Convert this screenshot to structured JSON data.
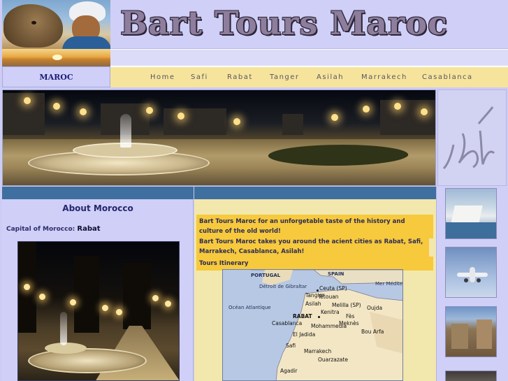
{
  "site": {
    "title": "Bart Tours Maroc"
  },
  "nav": {
    "left_label": "MAROC",
    "items": [
      "Home",
      "Safi",
      "Rabat",
      "Tanger",
      "Asilah",
      "Marrakech",
      "Casablanca"
    ]
  },
  "about": {
    "title": "About Morocco",
    "capital_label": "Capital of Morocco:",
    "capital_value": "Rabat"
  },
  "notes": [
    "Bart Tours Maroc for an unforgetable taste of the history and culture of the old world!",
    "Bart Tours Maroc takes you around the acient cities as Rabat, Safi, Marrakech, Casablanca, Asilah!",
    "Tours Itinerary"
  ],
  "map": {
    "regions": {
      "portugal": "PORTUGAL",
      "spain": "SPAIN",
      "strait": "Détroit de Gibraltar",
      "ocean": "Océan Atlantique",
      "sea": "Mer Méditerranée"
    },
    "cities": {
      "ceuta": "Ceuta",
      "ceuta_tag": "(SP)",
      "tetouan": "Tétouan",
      "tangier": "Tangier",
      "asilah": "Asilah",
      "melilla": "Melilla",
      "melilla_tag": "(SP)",
      "oujda": "Oujda",
      "kenitra": "Kenitra",
      "rabat": "RABAT",
      "fes": "Fès",
      "meknes": "Meknès",
      "casablanca": "Casablanca",
      "mohammedia": "Mohammedia",
      "eljadida": "El Jadida",
      "boufarfa": "Bou Arfa",
      "safi": "Safi",
      "marrakech": "Marrakech",
      "ouarzazate": "Ouarzazate",
      "agadir": "Agadir"
    }
  },
  "colors": {
    "header_bg": "#cfcff7",
    "nav_bg": "#f6e49d",
    "bar": "#3f6f9e",
    "note_bg": "#f7c93c",
    "content_bg": "#f2e7ad"
  }
}
